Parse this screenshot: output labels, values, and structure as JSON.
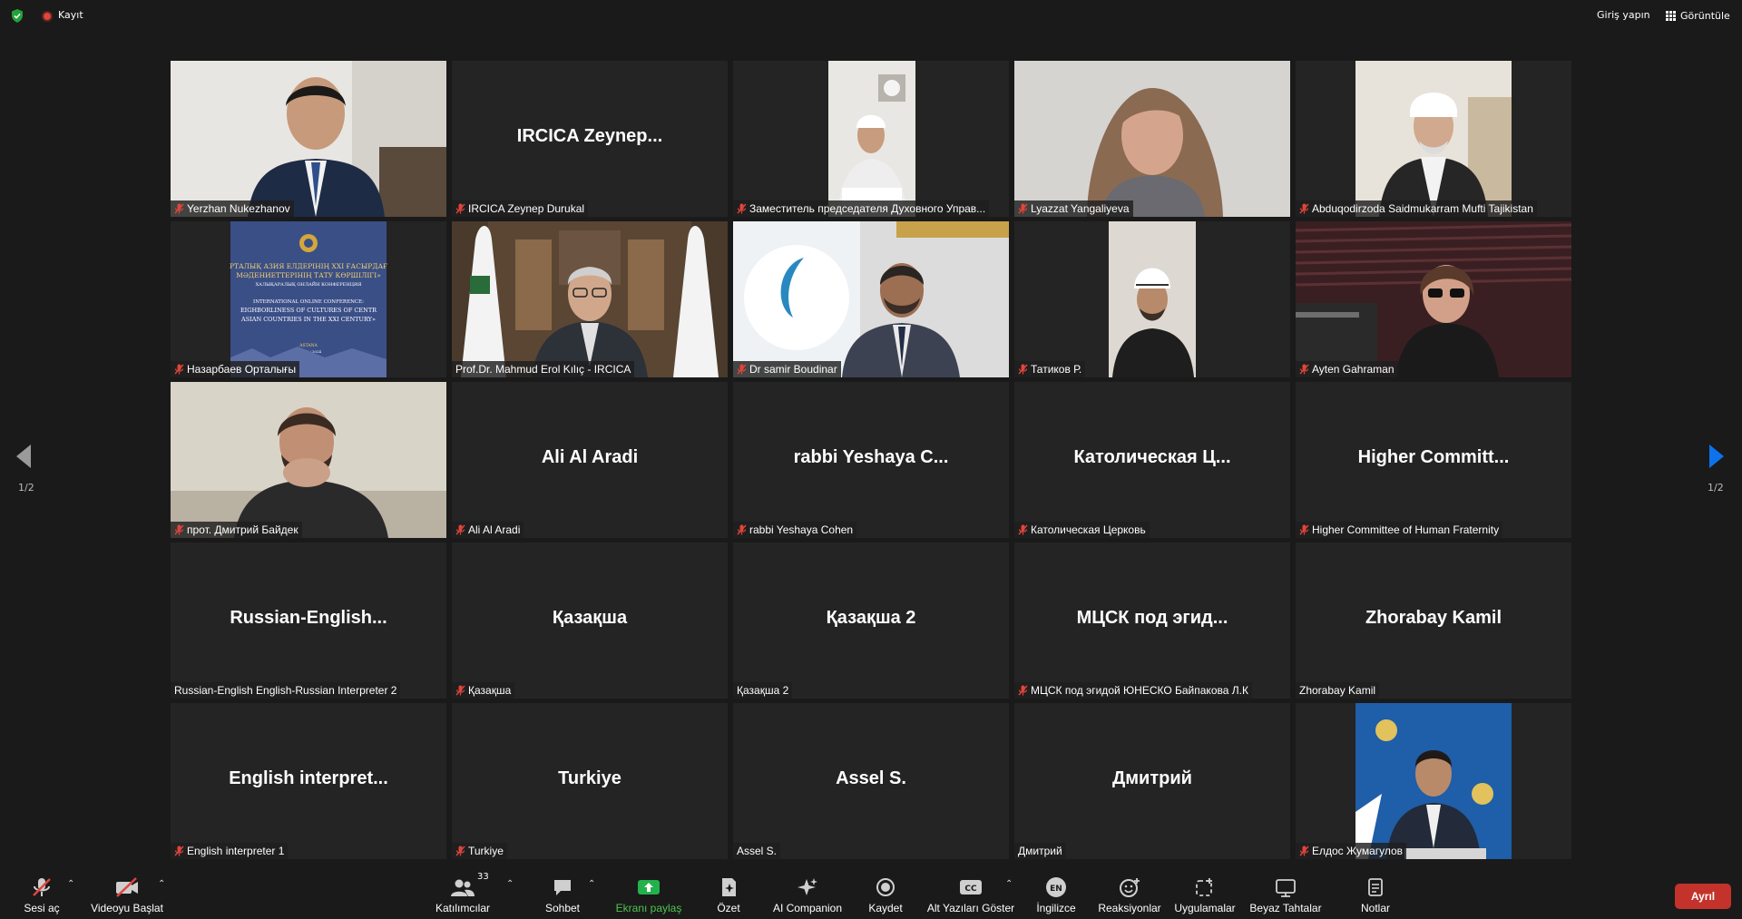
{
  "topbar": {
    "record_label": "Kayıt",
    "signin_label": "Giriş yapın",
    "view_label": "Görüntüle"
  },
  "pagination": {
    "left": "1/2",
    "right": "1/2"
  },
  "tiles": [
    {
      "name": "Yerzhan Nukezhanov",
      "big": "",
      "muted": true
    },
    {
      "name": "IRCICA Zeynep Durukal",
      "big": "IRCICA  Zeynep...",
      "muted": true
    },
    {
      "name": "Заместитель председателя Духовного Управ...",
      "big": "",
      "muted": true
    },
    {
      "name": "Lyazzat Yangaliyeva",
      "big": "",
      "muted": true
    },
    {
      "name": "Abduqodirzoda Saidmukarram Mufti Tajikistan",
      "big": "",
      "muted": true
    },
    {
      "name": "Назарбаев Орталығы",
      "big": "",
      "muted": true
    },
    {
      "name": "Prof.Dr. Mahmud Erol Kılıç - IRCICA",
      "big": "",
      "muted": false
    },
    {
      "name": "Dr samir Boudinar",
      "big": "",
      "muted": true
    },
    {
      "name": "Татиков Р.",
      "big": "",
      "muted": true
    },
    {
      "name": "Ayten Gahraman",
      "big": "",
      "muted": true
    },
    {
      "name": "прот. Дмитрий Байдек",
      "big": "",
      "muted": true
    },
    {
      "name": "Ali Al Aradi",
      "big": "Ali Al Aradi",
      "muted": true
    },
    {
      "name": "rabbi Yeshaya Cohen",
      "big": "rabbi Yeshaya C...",
      "muted": true
    },
    {
      "name": "Католическая Церковь",
      "big": "Католическая  Ц...",
      "muted": true
    },
    {
      "name": "Higher Committee of Human Fraternity",
      "big": "Higher  Committ...",
      "muted": true
    },
    {
      "name": "Russian-English English-Russian Interpreter 2",
      "big": "Russian-English...",
      "muted": false
    },
    {
      "name": "Қазақша",
      "big": "Қазақша",
      "muted": true
    },
    {
      "name": "Қазақша 2",
      "big": "Қазақша 2",
      "muted": false
    },
    {
      "name": "МЦСК под эгидой ЮНЕСКО Байпакова Л.К",
      "big": "МЦСК  под  эгид...",
      "muted": true
    },
    {
      "name": "Zhorabay Kamil",
      "big": "Zhorabay Kamil",
      "muted": false
    },
    {
      "name": "English interpreter 1",
      "big": "English  interpret...",
      "muted": true
    },
    {
      "name": "Turkiye",
      "big": "Turkiye",
      "muted": true
    },
    {
      "name": "Assel S.",
      "big": "Assel S.",
      "muted": false
    },
    {
      "name": "Дмитрий",
      "big": "Дмитрий",
      "muted": false
    },
    {
      "name": "Елдос Жумагулов",
      "big": "",
      "muted": true
    }
  ],
  "slide": {
    "line1": "РТАЛЫҚ АЗИЯ ЕЛДЕРІНІҢ XXI ҒАСЫРДАҒ",
    "line2": "МӘДЕНИЕТТЕРІНІҢ ТАТУ КӨРШІЛІГІ»",
    "line3": "ХАЛЫҚАРАЛЫҚ ОНЛАЙН КОНФЕРЕНЦИЯ",
    "line4": "INTERNATIONAL ONLINE CONFERENCE:",
    "line5": "EIGHBORLINESS OF CULTURES OF CENTR",
    "line6": "ASIAN COUNTRIES IN THE XXI CENTURY»",
    "line7": "ASTANA",
    "line8": "05 / 11 / 2024"
  },
  "toolbar": {
    "mic_label": "Sesi aç",
    "video_label": "Videoyu Başlat",
    "participants_label": "Katılımcılar",
    "participants_count": "33",
    "chat_label": "Sohbet",
    "share_label": "Ekranı paylaş",
    "summary_label": "Özet",
    "ai_label": "AI Companion",
    "record_label": "Kaydet",
    "cc_label": "Alt Yazıları Göster",
    "lang_label": "İngilizce",
    "lang_code": "EN",
    "reactions_label": "Reaksiyonlar",
    "apps_label": "Uygulamalar",
    "whiteboard_label": "Beyaz Tahtalar",
    "notes_label": "Notlar",
    "cc_code": "CC",
    "leave_label": "Ayrıl"
  },
  "colors": {
    "accent": "#0e72ed",
    "share_green": "#22b14c",
    "leave_red": "#c3332b",
    "active_border": "#e2d35e"
  }
}
